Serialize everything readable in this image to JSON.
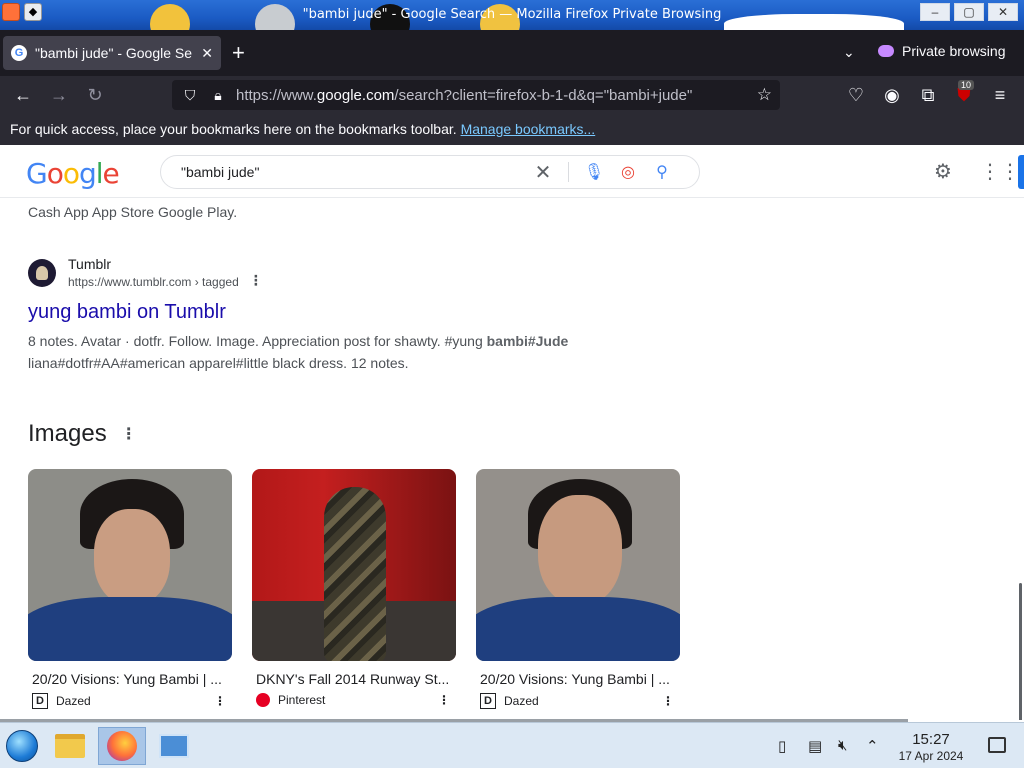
{
  "window": {
    "title": "\"bambi jude\" - Google Search — Mozilla Firefox Private Browsing",
    "buttons": [
      "–",
      "▢",
      "✕"
    ]
  },
  "browser": {
    "tab_title": "\"bambi jude\" - Google Se",
    "tab_close": "✕",
    "new_tab": "+",
    "private_label": "Private browsing",
    "url_prefix": "https://www.",
    "url_domain": "google.com",
    "url_rest": "/search?client=firefox-b-1-d&q=\"bambi+jude\"",
    "extension_badge": "10",
    "bookmarks_message": "For quick access, place your bookmarks here on the bookmarks toolbar.",
    "bookmarks_link": "Manage bookmarks..."
  },
  "google": {
    "logo": "Google",
    "query": "\"bambi jude\"",
    "colors": {
      "blue": "#4285f4",
      "red": "#ea4335",
      "yellow": "#fbbc05",
      "green": "#34a853",
      "link": "#1a0dab"
    }
  },
  "results": {
    "cut_text": "Cash App App Store Google Play.",
    "tumblr": {
      "site_name": "Tumblr",
      "site_url": "https://www.tumblr.com › tagged",
      "title": "yung bambi on Tumblr",
      "snippet_1": "8 notes. Avatar · dotfr. Follow. Image. Appreciation post for shawty. #yung ",
      "snippet_bold": "bambi#Jude",
      "snippet_2": "liana#dotfr#AA#american apparel#little black dress. 12 notes."
    },
    "images_heading": "Images",
    "images": [
      {
        "caption": "20/20 Visions: Yung Bambi | ...",
        "source": "Dazed",
        "source_logo": "D"
      },
      {
        "caption": "DKNY's Fall 2014 Runway St...",
        "source": "Pinterest",
        "source_logo": ""
      },
      {
        "caption": "20/20 Visions: Yung Bambi | ...",
        "source": "Dazed",
        "source_logo": "D"
      }
    ]
  },
  "taskbar": {
    "time": "15:27",
    "date": "17 Apr 2024"
  }
}
